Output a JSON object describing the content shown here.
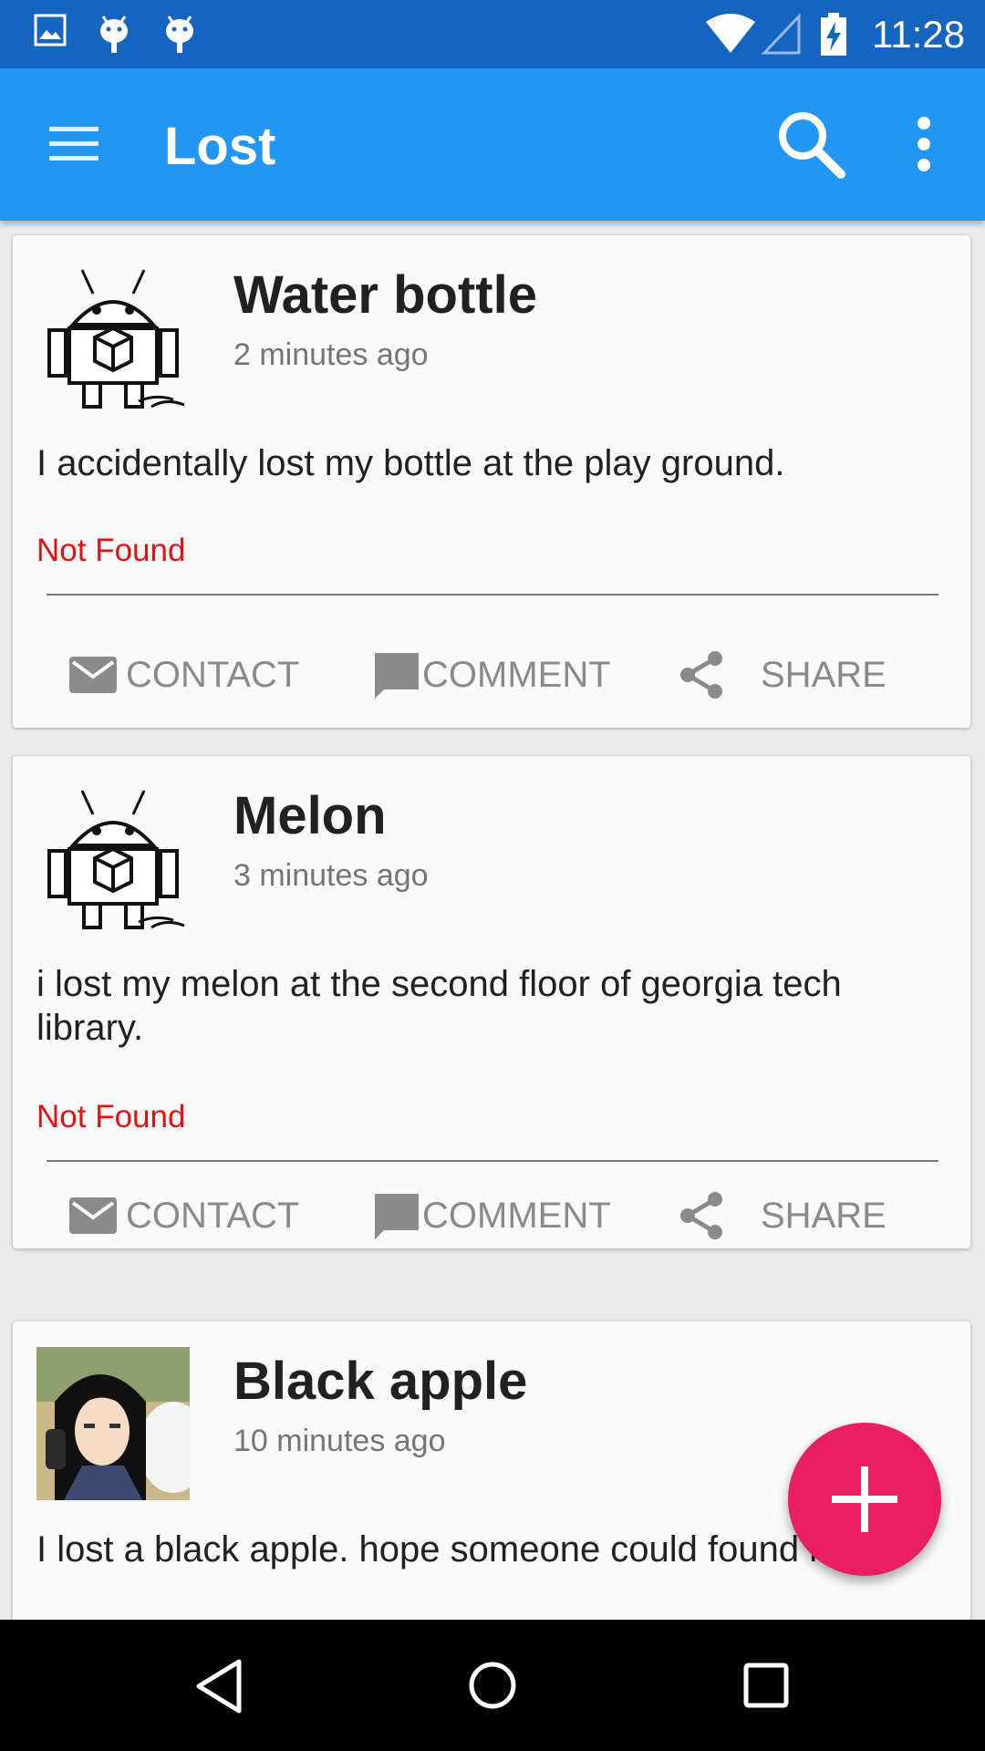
{
  "status_bar": {
    "time": "11:28",
    "left_icons": [
      "image-icon",
      "android-debug-icon",
      "android-debug-icon"
    ],
    "right_icons": [
      "wifi-icon",
      "signal-icon",
      "battery-charging-icon"
    ]
  },
  "app_bar": {
    "title": "Lost",
    "icons": [
      "menu-icon",
      "search-icon",
      "more-vert-icon"
    ]
  },
  "posts": [
    {
      "title": "Water bottle",
      "time": "2 minutes ago",
      "description": "I accidentally lost my bottle at the play ground.",
      "status": "Not Found",
      "actions": {
        "contact": "CONTACT",
        "comment": "COMMENT",
        "share": "SHARE"
      }
    },
    {
      "title": "Melon",
      "time": "3 minutes ago",
      "description": "i lost my melon at the second floor of georgia tech library.",
      "status": "Not Found",
      "actions": {
        "contact": "CONTACT",
        "comment": "COMMENT",
        "share": "SHARE"
      }
    },
    {
      "title": "Black apple",
      "time": "10 minutes ago",
      "description": "I lost a black apple. hope someone could found it."
    }
  ],
  "fab": {
    "icon": "plus-icon"
  },
  "nav_bar": {
    "icons": [
      "back-icon",
      "home-icon",
      "recents-icon"
    ]
  },
  "colors": {
    "primary": "#2196f3",
    "primary_dark": "#1565c0",
    "accent": "#e91e63",
    "status_red": "#e51010"
  }
}
